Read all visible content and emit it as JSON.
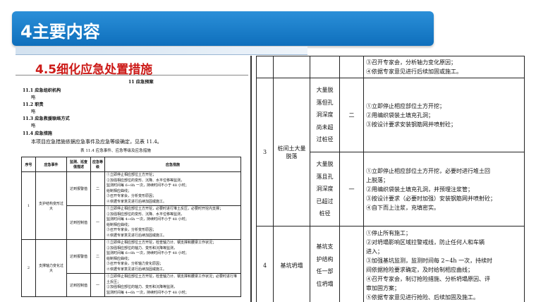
{
  "slide": {
    "title": "4主要内容",
    "section_title": "4.5细化应急处置措施"
  },
  "left_doc": {
    "chapter": "11  应急预案",
    "s1": "11.1 应急组织机构",
    "s1_body": "略",
    "s2": "11.2 职责",
    "s2_body": "略",
    "s3": "11.3 应急救援联络方式",
    "s3_body": "略",
    "s4": "11.4 应急措施",
    "intro": "本项目应急措施依据应急事件及应急等级确定，见表 11.4。",
    "caption": "表 11.4  应急事件、应急等级及应急措施",
    "headers": [
      "序号",
      "应急事件",
      "监测、巡查值描述",
      "应急等级",
      "应急措施"
    ],
    "rows": [
      {
        "no": "1",
        "event": "支护结构变形过大",
        "desc": "达到报警值",
        "level": "二",
        "lines": [
          "①立即停止相应部位土方开挖；",
          "②加强相应部位的变形、沉降、水平位移等监测，",
          "监测时间每 6~8h 一次，持续时间不小于 48 小时；",
          "给制相应曲线；",
          "③召开专家会，分析变形原因；",
          "④依据专家意见进行后续加固或施工。"
        ]
      },
      {
        "no": "",
        "event": "",
        "desc": "达到控制值",
        "level": "一",
        "lines": [
          "①立即停止相应部位土方开挖，必要时进行堆土反压，必要时开挖内支撑；",
          "②加强相应部位的变形、沉降、水平位移等监测，",
          "监测时间每 4~6h 一次，持续时间不小于 48 小时；",
          "给制相应曲线；",
          "③召开专家会，分析变形原因；",
          "④依据专家意见进行后续加固或施工。"
        ]
      },
      {
        "no": "2",
        "event": "支撑轴力变化过大",
        "desc": "达到报警值",
        "level": "二",
        "lines": [
          "①立即停止相应部位土方开挖，检查轴力计、钢支撑和腰梁工作状况；",
          "②加强相应部位的轴力、变形和沉降等监测，",
          "监测时间每 6~8h 一次，持续时间不小于 48 小时；",
          "给制相应曲线；",
          "③召开专家会，分析轴力变化原因；",
          "④依据专家意见进行后续加固或施工。"
        ]
      },
      {
        "no": "",
        "event": "",
        "desc": "达到控制值",
        "level": "一",
        "lines": [
          "①立即停止相应部位土方开挖，检查轴力计、钢支撑和腰梁工作状况；必要时进行堆土反压；",
          "②加强相应部位的轴力、变形和沉降等监测，",
          "监测时间每 4~6h 一次，持续时间不小于 48 小时；"
        ]
      }
    ]
  },
  "right_doc": {
    "top_lines": [
      "③召开专家会，分析轴力变化原因；",
      "④依据专家意见进行后续加固或施工。"
    ],
    "row3": {
      "no": "3",
      "event": "桩间土大量脱落",
      "sub": [
        {
          "desc": [
            "大量脱",
            "落但孔",
            "洞深度",
            "尚未超",
            "过桩径"
          ],
          "level": "二",
          "lines": [
            "①立即停止相应部位土方开挖；",
            "②用编织袋装土填充孔洞；",
            "③按设计要求安装钢筋网并喷射砼；"
          ]
        },
        {
          "desc": [
            "大量脱",
            "落且孔",
            "洞深度",
            "已超过",
            "桩径"
          ],
          "level": "一",
          "lines": [
            "①立即停止相应部位土方开挖，必要时进行堆土回",
            "上脱落；",
            "②用编织袋装土填充孔洞，并预埋注浆管；",
            "③按设计要求（必要时加强）安装钢筋网并喷射砼；",
            "④自下而上注浆，充填密实。"
          ]
        }
      ]
    },
    "row4": {
      "no": "4",
      "event": "基坑坍塌",
      "desc": [
        "基坑支",
        "护结构",
        "任一部",
        "位坍塌"
      ],
      "level": "",
      "lines": [
        "①停止所有施工；",
        "②对坍塌影响区域拉警戒线，防止任何人和车辆",
        "进入；",
        "③加强基坑监测，监测时间每 2~4h 一次，持续时",
        "间依据抢险要求确定，及时给制相应曲线；",
        "④召开专家会，制订抢险措施、分析坍塌原因、评",
        "审加固方案；",
        "⑤依据专家意见进行抢险、后续加固及施工。"
      ]
    }
  }
}
